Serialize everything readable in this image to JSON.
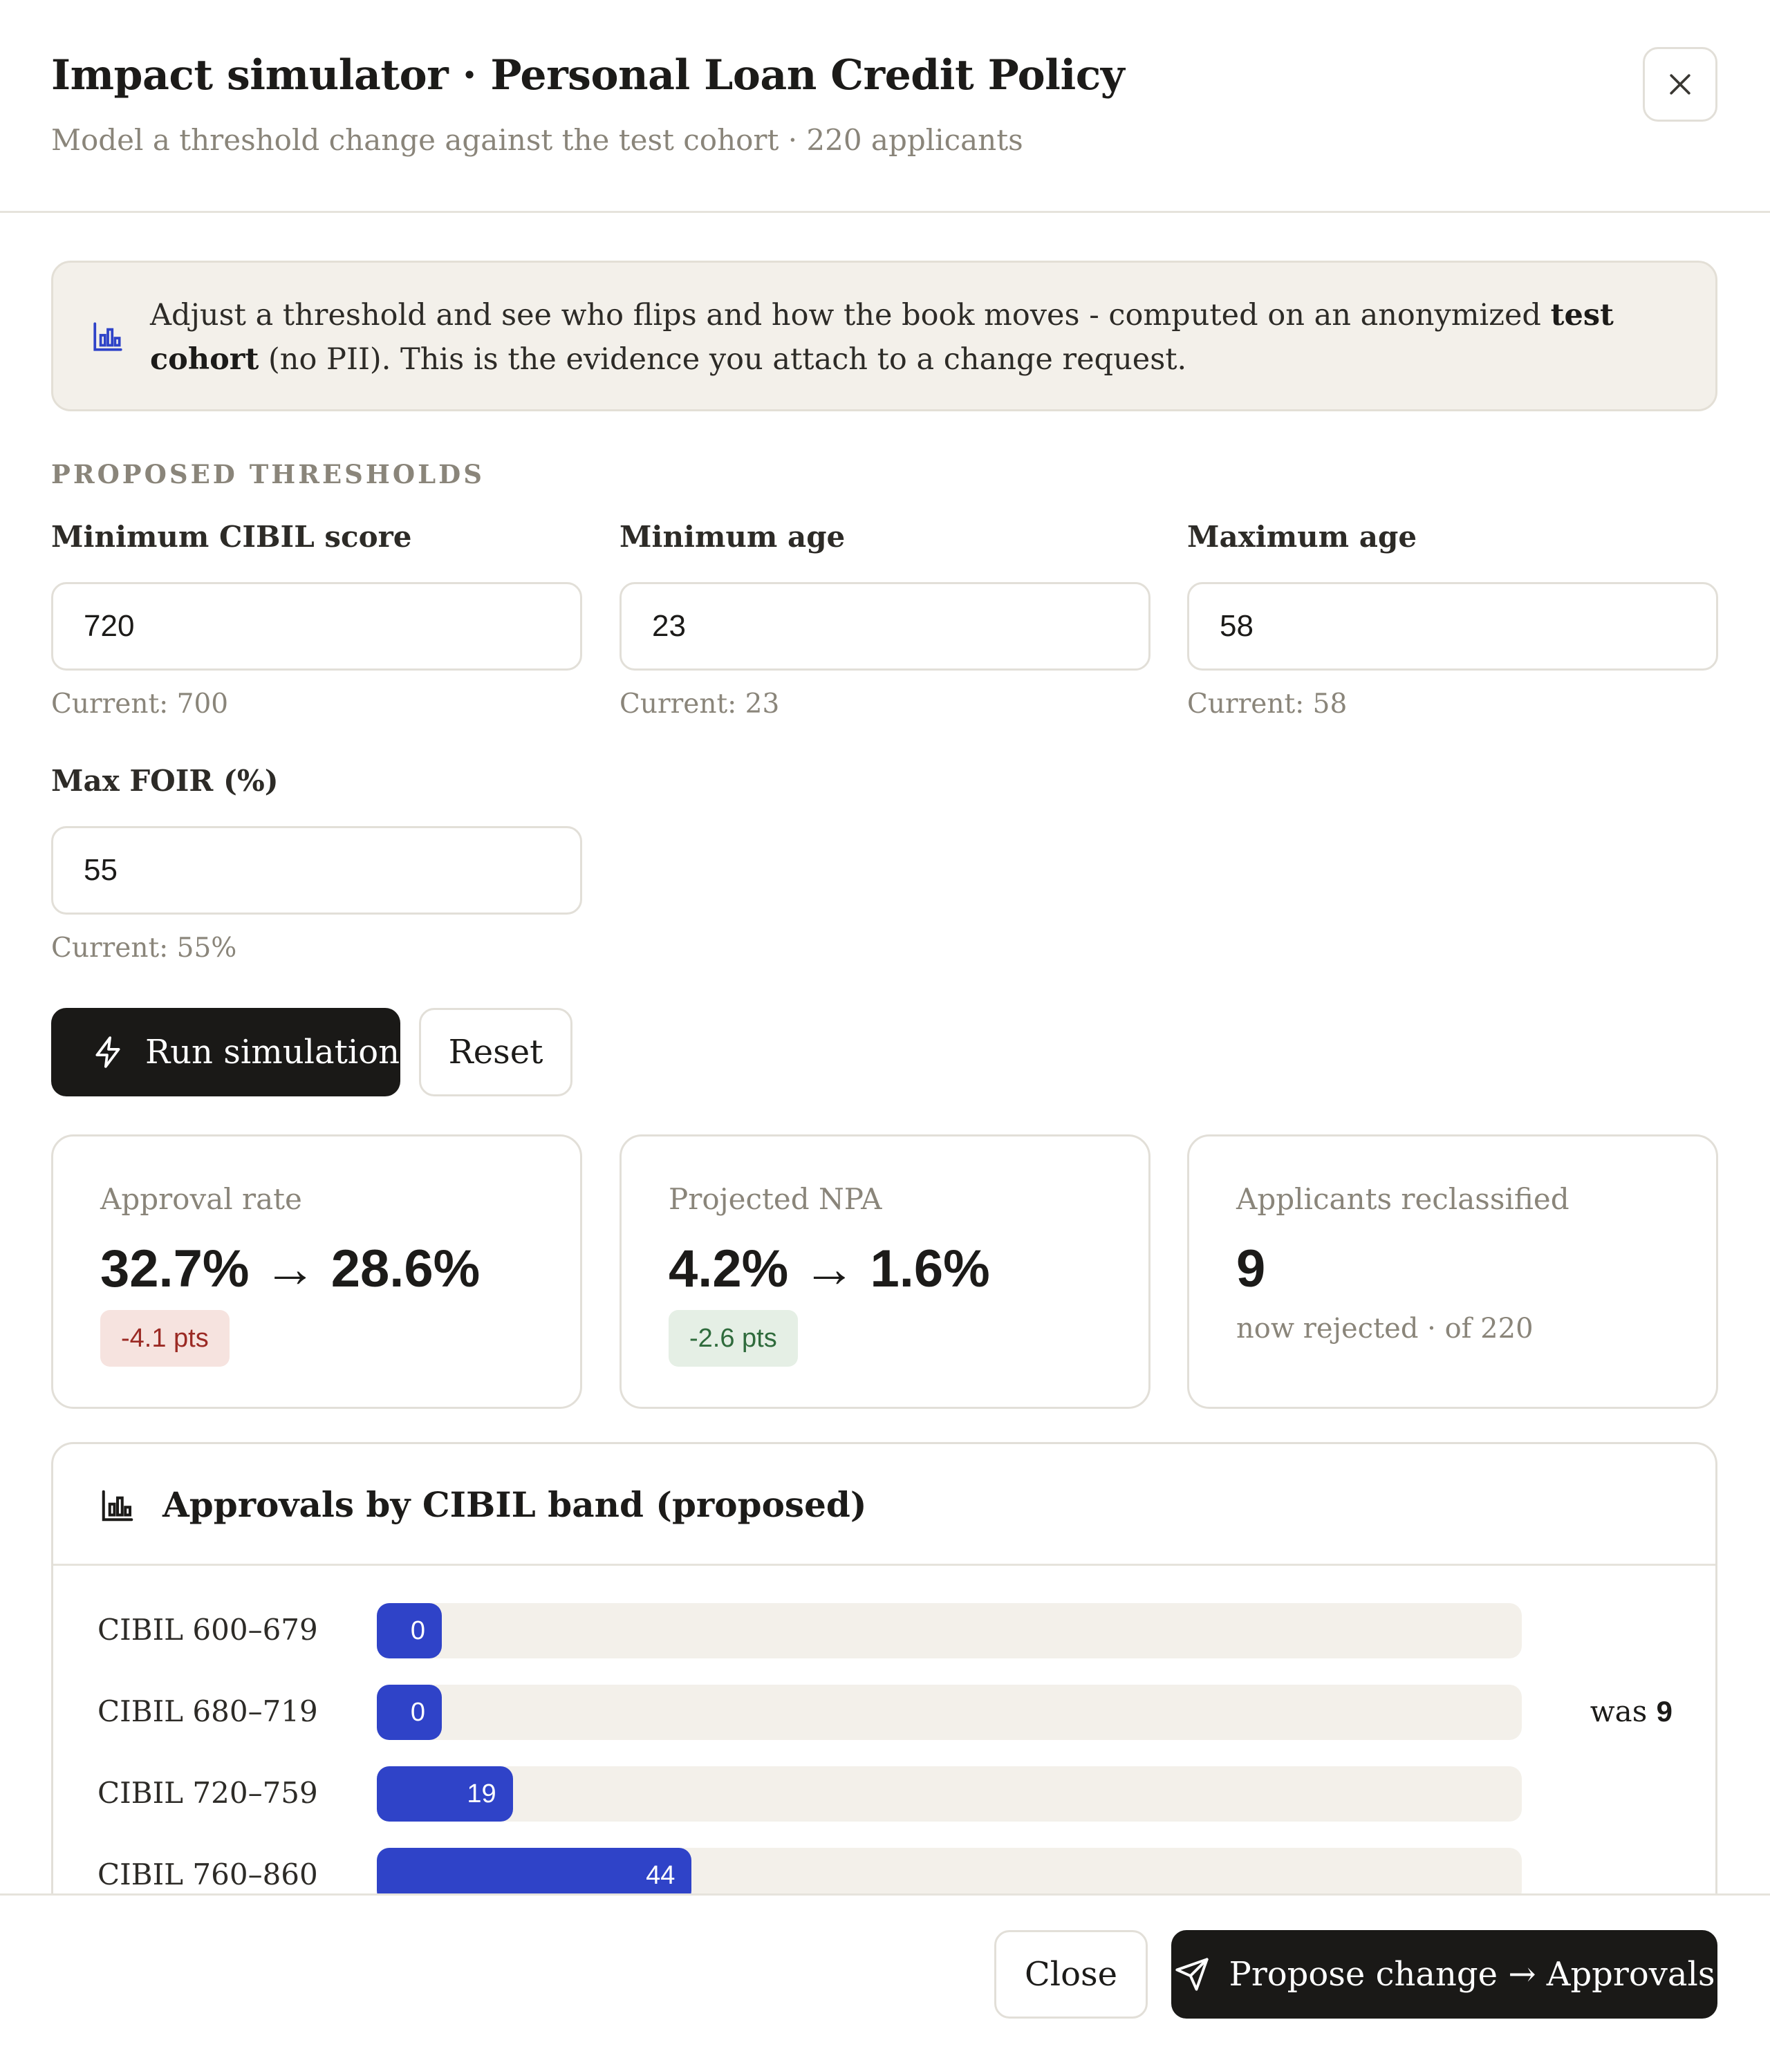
{
  "header": {
    "title": "Impact simulator · Personal Loan Credit Policy",
    "subtitle": "Model a threshold change against the test cohort · 220 applicants"
  },
  "banner": {
    "text_before": "Adjust a threshold and see who flips and how the book moves - computed on an anonymized ",
    "text_bold": "test cohort",
    "text_after": " (no PII). This is the evidence you attach to a change request."
  },
  "thresholds": {
    "section_label": "PROPOSED THRESHOLDS",
    "min_cibil": {
      "label": "Minimum CIBIL score",
      "value": "720",
      "hint": "Current: 700"
    },
    "min_age": {
      "label": "Minimum age",
      "value": "23",
      "hint": "Current: 23"
    },
    "max_age": {
      "label": "Maximum age",
      "value": "58",
      "hint": "Current: 58"
    },
    "max_foir": {
      "label": "Max FOIR (%)",
      "value": "55",
      "hint": "Current: 55%"
    }
  },
  "actions": {
    "run_label": "Run simulation",
    "reset_label": "Reset"
  },
  "metrics": {
    "approval": {
      "label": "Approval rate",
      "value": "32.7% → 28.6%",
      "delta": "-4.1 pts"
    },
    "npa": {
      "label": "Projected NPA",
      "value": "4.2% → 1.6%",
      "delta": "-2.6 pts"
    },
    "reclassified": {
      "label": "Applicants reclassified",
      "value": "9",
      "note": "now rejected · of 220"
    }
  },
  "chart": {
    "title": "Approvals by CIBIL band (proposed)"
  },
  "chart_data": {
    "type": "bar",
    "orientation": "horizontal",
    "categories": [
      "CIBIL 600–679",
      "CIBIL 680–719",
      "CIBIL 720–759",
      "CIBIL 760–860"
    ],
    "values": [
      0,
      0,
      19,
      44
    ],
    "previous": [
      null,
      9,
      null,
      null
    ],
    "previous_prefix": "was",
    "xlim": [
      0,
      160
    ],
    "colors": {
      "bar": "#2f43c8",
      "track": "#f3f0ea"
    }
  },
  "footer": {
    "close_label": "Close",
    "propose_label": "Propose change → Approvals"
  }
}
